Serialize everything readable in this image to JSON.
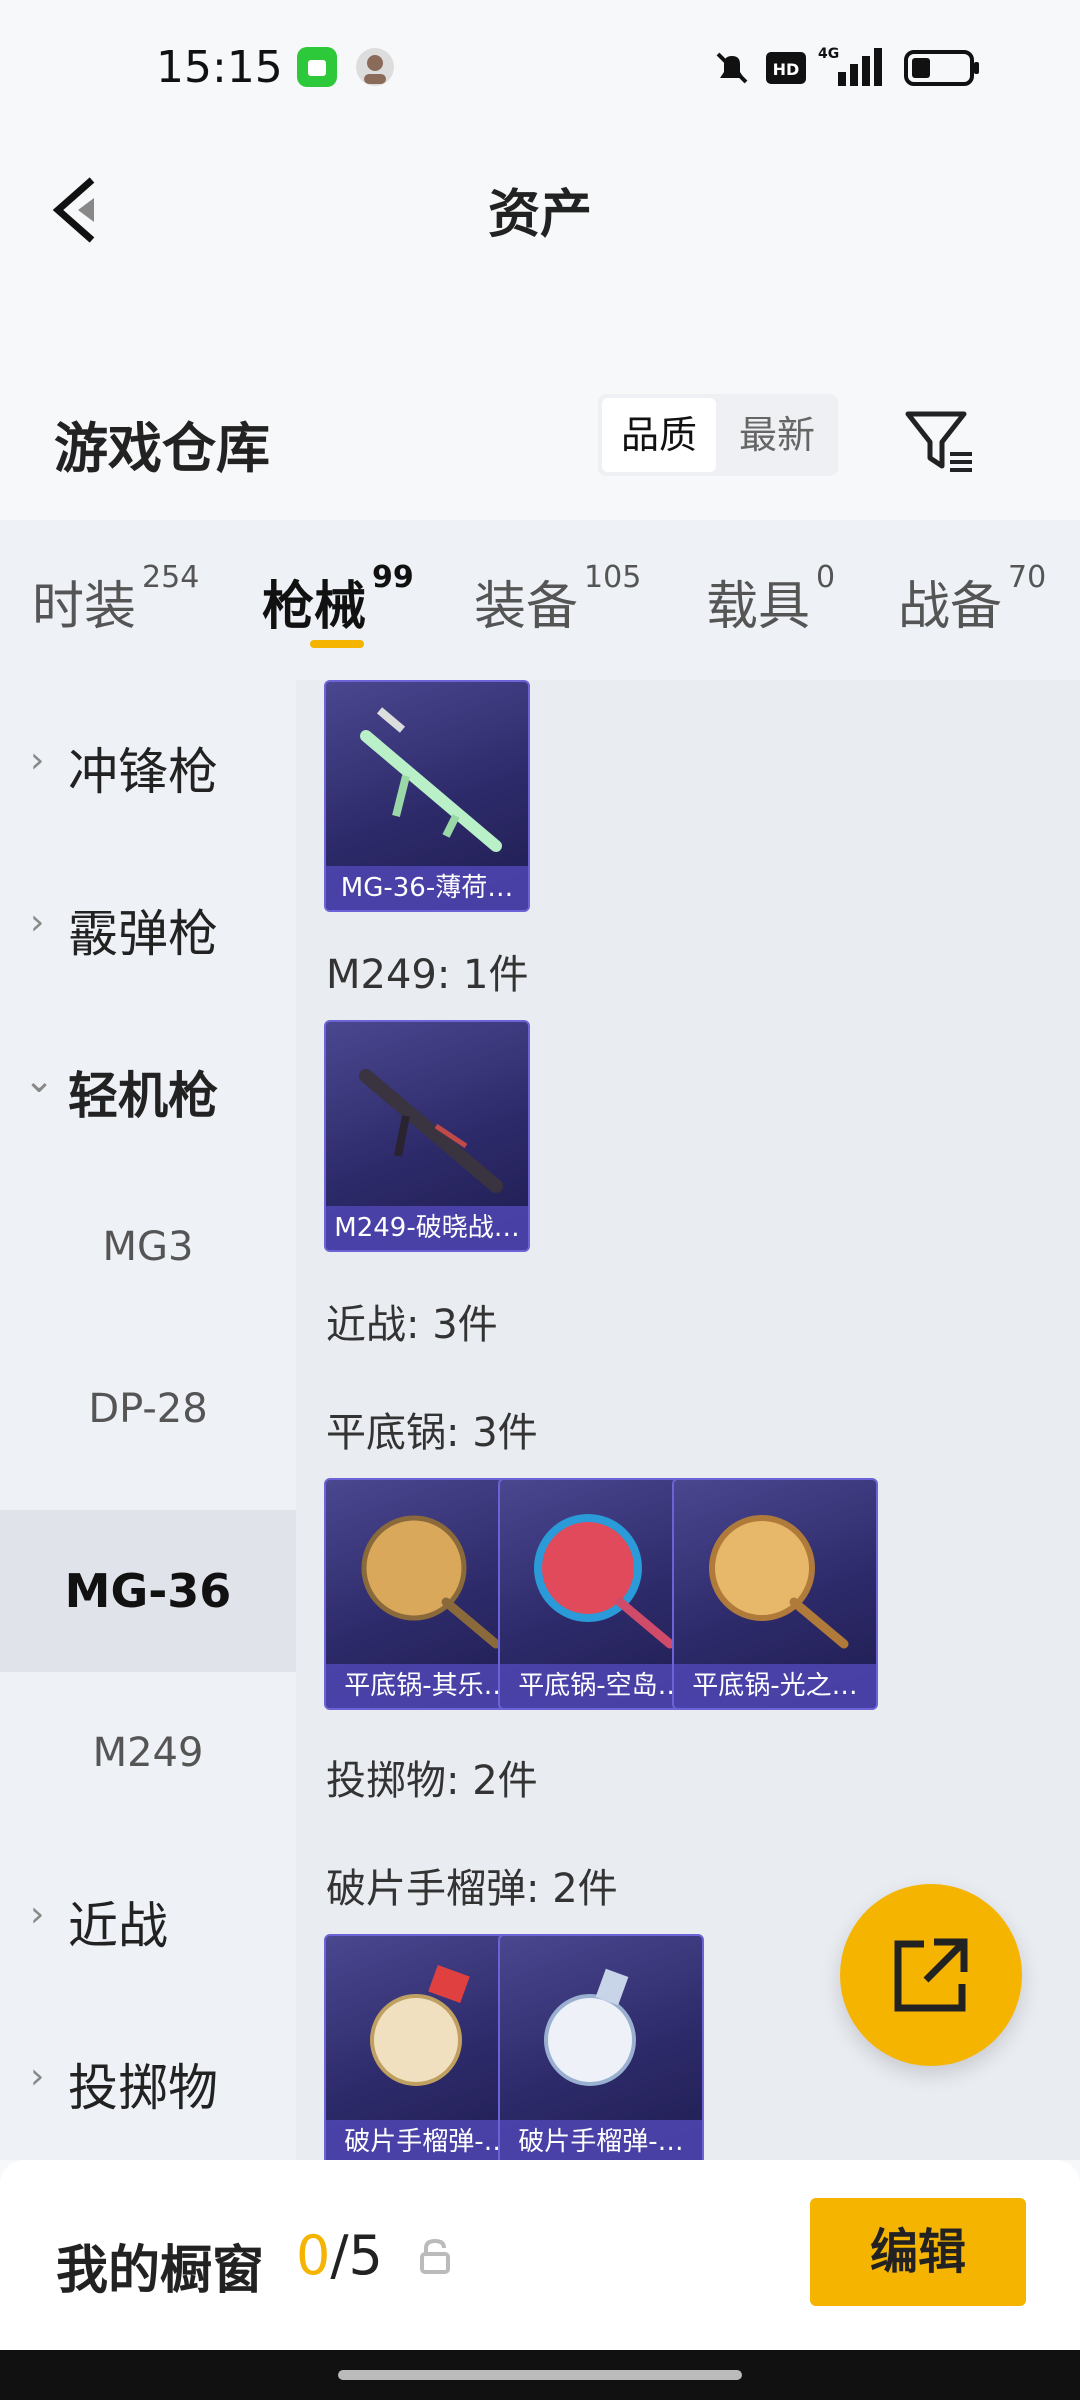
{
  "status_bar": {
    "time": "15:15",
    "icons": [
      "app-notification-icon",
      "avatar-icon",
      "bell-muted-icon",
      "hd-icon",
      "signal-4g-icon",
      "battery-icon"
    ],
    "network": "4G",
    "hd": "HD"
  },
  "header": {
    "title": "资产",
    "back_icon": "chevron-left-icon"
  },
  "warehouse": {
    "title": "游戏仓库",
    "sort_options": [
      "品质",
      "最新"
    ],
    "sort_selected": "品质",
    "filter_icon": "filter-icon"
  },
  "tabs": [
    {
      "label": "时装",
      "count": "254",
      "active": false
    },
    {
      "label": "枪械",
      "count": "99",
      "active": true
    },
    {
      "label": "装备",
      "count": "105",
      "active": false
    },
    {
      "label": "载具",
      "count": "0",
      "active": false
    },
    {
      "label": "战备",
      "count": "70",
      "active": false
    }
  ],
  "sidebar": {
    "categories": [
      {
        "label": "冲锋枪",
        "expanded": false
      },
      {
        "label": "霰弹枪",
        "expanded": false
      },
      {
        "label": "轻机枪",
        "expanded": true
      },
      {
        "label": "近战",
        "expanded": false
      },
      {
        "label": "投掷物",
        "expanded": false
      }
    ],
    "subitems": [
      "MG3",
      "DP-28",
      "MG-36",
      "M249"
    ],
    "selected_subitem": "MG-36"
  },
  "content": {
    "items_mg36": [
      {
        "name": "MG-36-薄荷…"
      }
    ],
    "label_m249": "M249: 1件",
    "items_m249": [
      {
        "name": "M249-破晓战…"
      }
    ],
    "label_melee": "近战: 3件",
    "label_pan": "平底锅: 3件",
    "items_pan": [
      {
        "name": "平底锅-其乐…"
      },
      {
        "name": "平底锅-空岛…"
      },
      {
        "name": "平底锅-光之…"
      }
    ],
    "label_throwable": "投掷物: 2件",
    "label_grenade": "破片手榴弹: 2件",
    "items_grenade": [
      {
        "name": "破片手榴弹-…"
      },
      {
        "name": "破片手榴弹-…"
      }
    ]
  },
  "fab_icon": "share-icon",
  "bottom_bar": {
    "title": "我的橱窗",
    "count_current": "0",
    "count_total": "/5",
    "lock_icon": "lock-icon",
    "edit_label": "编辑"
  },
  "colors": {
    "accent": "#f5b400",
    "card_bg": "#2d2a6a"
  }
}
